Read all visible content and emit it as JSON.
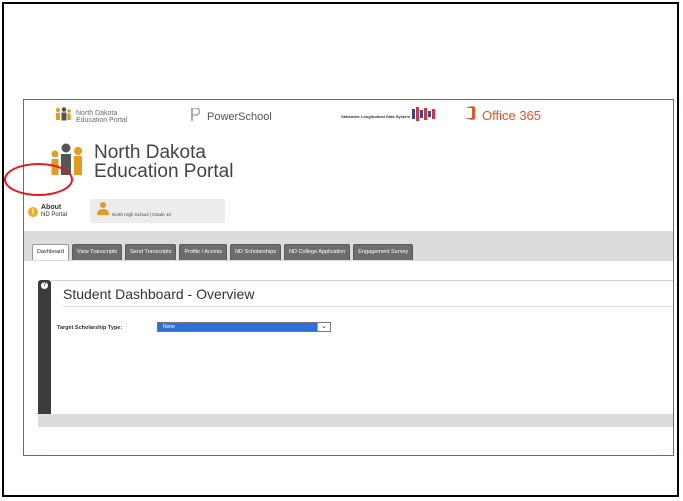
{
  "logos": {
    "nd_small": "North Dakota Education Portal",
    "powerschool": "PowerSchool",
    "slds": "Statewide Longitudinal Data System",
    "office365": "Office 365"
  },
  "portal_logo": {
    "line1": "North Dakota",
    "line2": "Education Portal"
  },
  "about": {
    "title": "About",
    "subtitle": "ND Portal"
  },
  "student_chip": {
    "name": "North High School | Grade 10"
  },
  "tabs": [
    {
      "label": "Dashboard"
    },
    {
      "label": "View Transcripts"
    },
    {
      "label": "Send Transcripts"
    },
    {
      "label": "Profile / Access"
    },
    {
      "label": "ND Scholarships"
    },
    {
      "label": "ND College Application"
    },
    {
      "label": "Engagement Survey"
    }
  ],
  "dashboard": {
    "title": "Student Dashboard - Overview",
    "scholarship_label": "Target Scholarship Type:",
    "scholarship_value": "None"
  },
  "colors": {
    "highlight_border": "#e03a3a",
    "circle_annotation": "#e11a1a",
    "office_orange": "#e5532e",
    "select_blue": "#2f6fd6"
  }
}
